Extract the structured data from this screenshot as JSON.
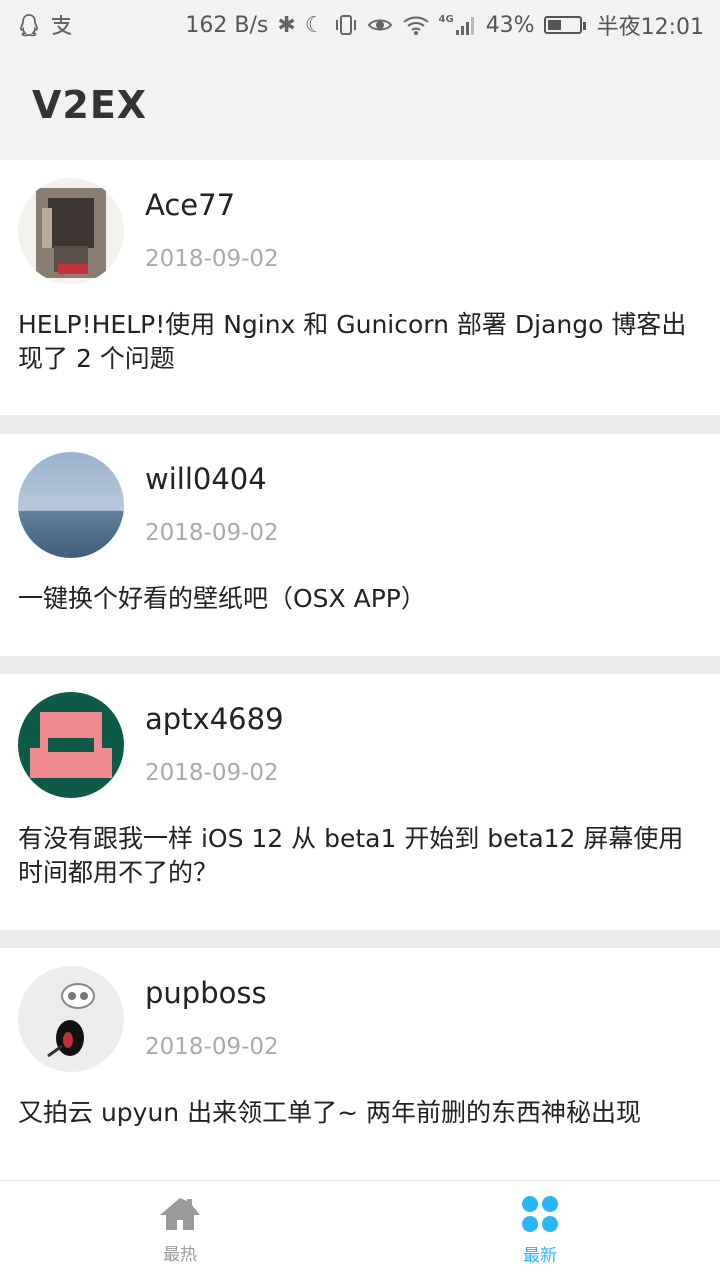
{
  "status_bar": {
    "left_icons": [
      "qq-icon",
      "alipay-icon"
    ],
    "network_speed": "162 B/s",
    "signal_badge": "4G",
    "battery_percent": "43%",
    "battery_level": 0.43,
    "time": "半夜12:01"
  },
  "app": {
    "title": "V2EX"
  },
  "topics": [
    {
      "username": "Ace77",
      "date": "2018-09-02",
      "title": "HELP!HELP!使用 Nginx 和 Gunicorn 部署 Django 博客出现了 2 个问题"
    },
    {
      "username": "will0404",
      "date": "2018-09-02",
      "title": "一键换个好看的壁纸吧（OSX APP）"
    },
    {
      "username": "aptx4689",
      "date": "2018-09-02",
      "title": "有没有跟我一样 iOS 12 从 beta1 开始到 beta12 屏幕使用时间都用不了的？"
    },
    {
      "username": "pupboss",
      "date": "2018-09-02",
      "title": "又拍云 upyun 出来领工单了~ 两年前删的东西神秘出现"
    }
  ],
  "bottom_nav": {
    "items": [
      {
        "label": "最热",
        "icon": "home-icon",
        "active": false
      },
      {
        "label": "最新",
        "icon": "grid-icon",
        "active": true
      }
    ],
    "active_color": "#29b6f6",
    "inactive_color": "#9a9a9a"
  }
}
